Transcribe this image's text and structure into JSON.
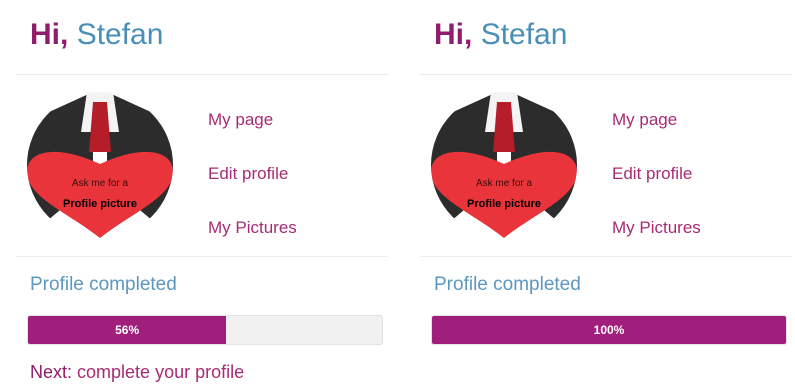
{
  "panels": [
    {
      "greeting": {
        "hi": "Hi,",
        "name": "Stefan"
      },
      "avatar": {
        "caption_line1": "Ask me for a",
        "caption_line2": "Profile picture"
      },
      "menu": {
        "my_page": "My page",
        "edit_profile": "Edit profile",
        "my_pictures": "My Pictures"
      },
      "profile_completed": {
        "label": "Profile completed",
        "progress_text": "56%",
        "progress_percent": 56,
        "fill_color": "#a11f7c"
      },
      "next_step": {
        "label": "Next:",
        "action": "complete your profile"
      }
    },
    {
      "greeting": {
        "hi": "Hi,",
        "name": "Stefan"
      },
      "avatar": {
        "caption_line1": "Ask me for a",
        "caption_line2": "Profile picture"
      },
      "menu": {
        "my_page": "My page",
        "edit_profile": "Edit profile",
        "my_pictures": "My Pictures"
      },
      "profile_completed": {
        "label": "Profile completed",
        "progress_text": "100%",
        "progress_percent": 100,
        "fill_color": "#a11f7c"
      }
    }
  ]
}
